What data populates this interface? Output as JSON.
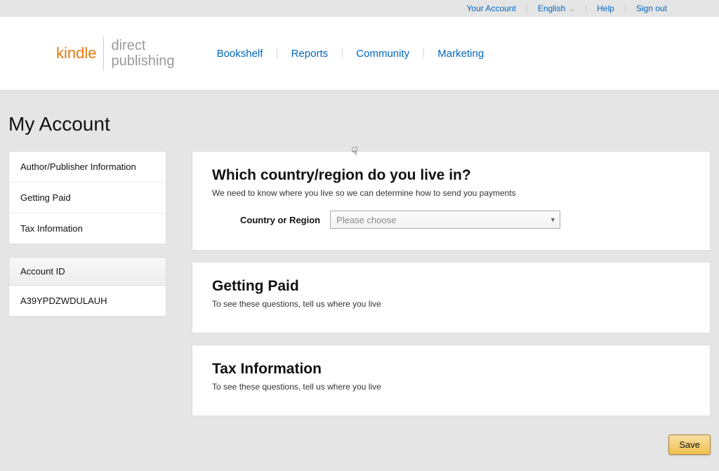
{
  "topbar": {
    "account": "Your Account",
    "language": "English",
    "help": "Help",
    "signout": "Sign out"
  },
  "logo": {
    "kindle": "kindle",
    "direct": "direct",
    "publishing": "publishing"
  },
  "nav": {
    "bookshelf": "Bookshelf",
    "reports": "Reports",
    "community": "Community",
    "marketing": "Marketing"
  },
  "page_title": "My Account",
  "sidebar": {
    "items": {
      "author": "Author/Publisher Information",
      "paid": "Getting Paid",
      "tax": "Tax Information"
    },
    "account_id_label": "Account ID",
    "account_id_value": "A39YPDZWDULAUH"
  },
  "panels": {
    "country": {
      "title": "Which country/region do you live in?",
      "subtext": "We need to know where you live so we can determine how to send you payments",
      "field_label": "Country or Region",
      "placeholder": "Please choose"
    },
    "paid": {
      "title": "Getting Paid",
      "subtext": "To see these questions, tell us where you live"
    },
    "tax": {
      "title": "Tax Information",
      "subtext": "To see these questions, tell us where you live"
    }
  },
  "actions": {
    "save": "Save"
  }
}
